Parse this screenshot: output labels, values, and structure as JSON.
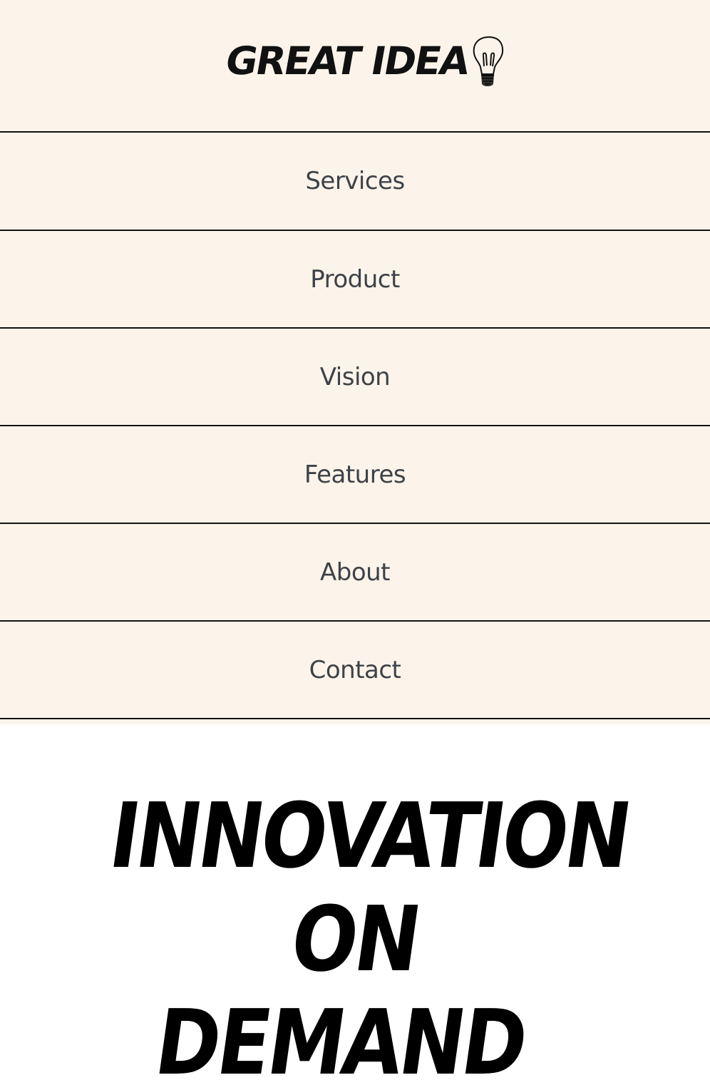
{
  "brand": {
    "name": "GREAT IDEA",
    "icon": "lightbulb-icon"
  },
  "nav": {
    "items": [
      {
        "label": "Services"
      },
      {
        "label": "Product"
      },
      {
        "label": "Vision"
      },
      {
        "label": "Features"
      },
      {
        "label": "About"
      },
      {
        "label": "Contact"
      }
    ]
  },
  "hero": {
    "lines": [
      "INNOVATION",
      "ON",
      "DEMAND"
    ]
  },
  "colors": {
    "header_bg": "#fcf4ea",
    "nav_text": "#3d4248",
    "divider": "#111111",
    "hero_text": "#000000"
  }
}
